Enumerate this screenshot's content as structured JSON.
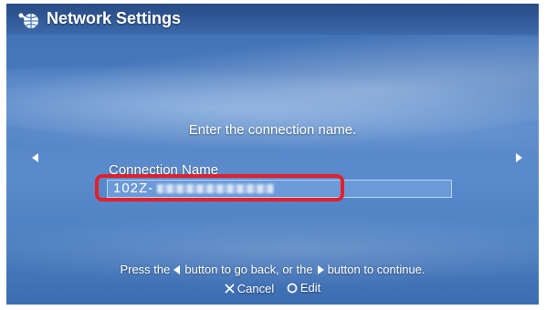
{
  "header": {
    "title": "Network Settings",
    "icon": "network-globe-icon"
  },
  "main": {
    "prompt": "Enter the connection name.",
    "field_label": "Connection Name",
    "field_value": "102Z-",
    "field_value_masked": true
  },
  "footer": {
    "hint_part1": "Press the",
    "hint_part2": "button to go back, or the",
    "hint_part3": "button to continue.",
    "cancel_label": "Cancel",
    "edit_label": "Edit"
  },
  "colors": {
    "background": "#4a7cc0",
    "highlight": "#e2202a",
    "text": "#ffffff"
  }
}
